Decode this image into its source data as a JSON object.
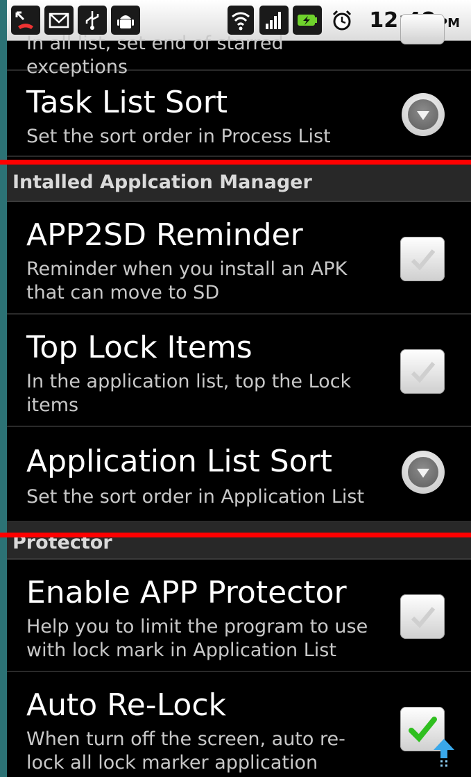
{
  "status_bar": {
    "time": "12:48",
    "ampm": "PM"
  },
  "top_partial": {
    "summary": "In all list, set end of starred exceptions"
  },
  "rows": {
    "task_list_sort": {
      "title": "Task List Sort",
      "summary": "Set the sort order in Process List"
    },
    "app2sd": {
      "title": "APP2SD Reminder",
      "summary": "Reminder when you install an APK that can move to SD",
      "checked": false
    },
    "top_lock": {
      "title": "Top Lock Items",
      "summary": "In the application list, top the Lock items",
      "checked": false
    },
    "app_list_sort": {
      "title": "Application List Sort",
      "summary": "Set the sort order in Application List"
    },
    "enable_protector": {
      "title": "Enable APP Protector",
      "summary": "Help you to limit the program to use with lock mark in Application List",
      "checked": false
    },
    "auto_relock": {
      "title": "Auto Re-Lock",
      "summary": "When turn off the screen, auto re-lock all lock marker application",
      "checked": true
    }
  },
  "categories": {
    "installed_manager": "Intalled Applcation Manager",
    "protector": "Protector"
  },
  "colors": {
    "highlight": "#ff0000",
    "check_green": "#2fbf1f"
  }
}
